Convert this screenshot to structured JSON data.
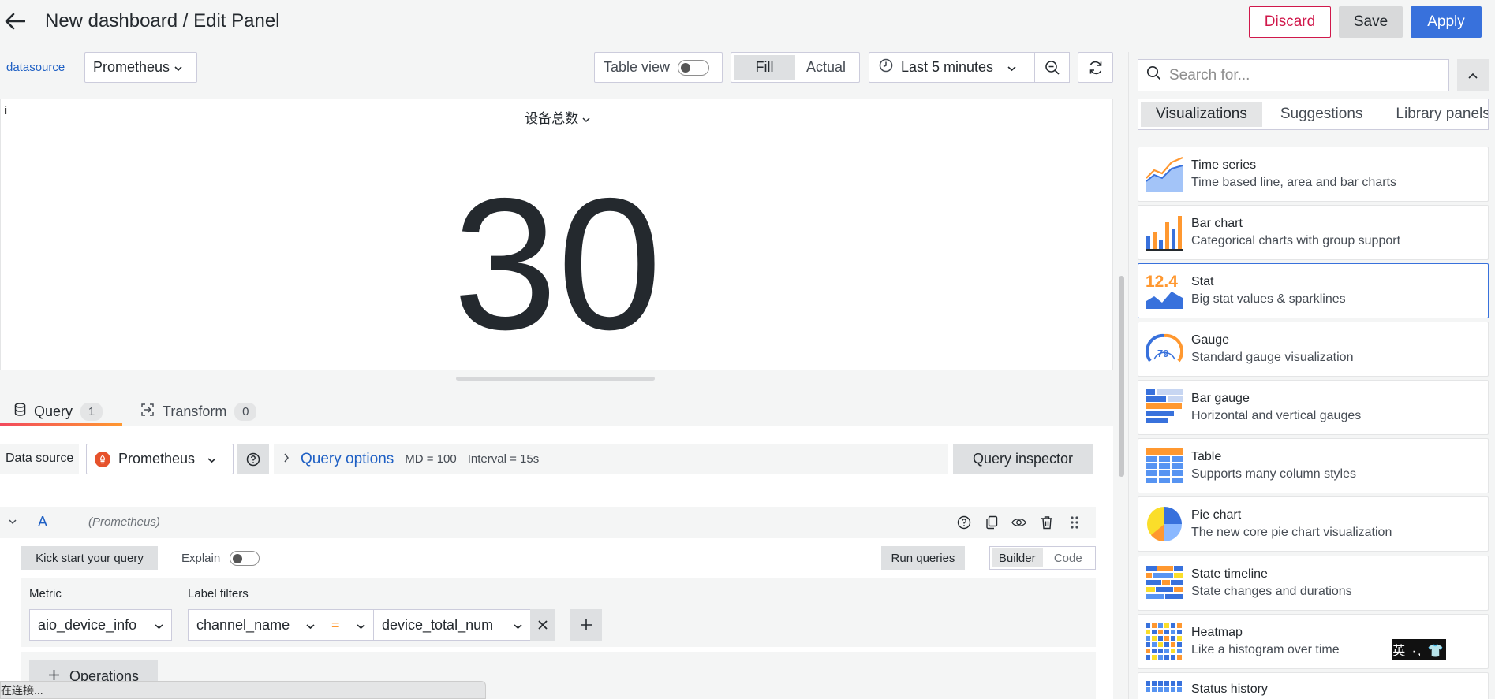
{
  "header": {
    "title": "New dashboard / Edit Panel",
    "discard_label": "Discard",
    "save_label": "Save",
    "apply_label": "Apply"
  },
  "toolbar": {
    "variable_label": "datasource",
    "variable_value": "Prometheus",
    "table_view_label": "Table view",
    "fill_label": "Fill",
    "actual_label": "Actual",
    "time_range": "Last 5 minutes"
  },
  "panel": {
    "title": "设备总数",
    "info_glyph": "i",
    "value": "30"
  },
  "query_tabs": {
    "query_label": "Query",
    "query_count": "1",
    "transform_label": "Transform",
    "transform_count": "0"
  },
  "query_bar": {
    "data_source_label": "Data source",
    "data_source_value": "Prometheus",
    "query_options_label": "Query options",
    "md": "MD = 100",
    "interval": "Interval = 15s",
    "inspector_label": "Query inspector"
  },
  "query_a": {
    "ref": "A",
    "datasource": "(Prometheus)",
    "kick_start_label": "Kick start your query",
    "explain_label": "Explain",
    "run_label": "Run queries",
    "builder_label": "Builder",
    "code_label": "Code",
    "metric_label": "Metric",
    "metric_value": "aio_device_info",
    "label_filters_label": "Label filters",
    "label_key": "channel_name",
    "operator": "=",
    "label_value": "device_total_num",
    "operations_label": "Operations"
  },
  "status_text": "在连接...",
  "right_pane": {
    "search_placeholder": "Search for...",
    "tabs": [
      "Visualizations",
      "Suggestions",
      "Library panels"
    ],
    "items": [
      {
        "name": "Time series",
        "desc": "Time based line, area and bar charts",
        "icon": "time-series-icon"
      },
      {
        "name": "Bar chart",
        "desc": "Categorical charts with group support",
        "icon": "bar-chart-icon"
      },
      {
        "name": "Stat",
        "desc": "Big stat values & sparklines",
        "icon": "stat-icon",
        "icon_value": "12.4"
      },
      {
        "name": "Gauge",
        "desc": "Standard gauge visualization",
        "icon": "gauge-icon",
        "icon_value": "79"
      },
      {
        "name": "Bar gauge",
        "desc": "Horizontal and vertical gauges",
        "icon": "bar-gauge-icon"
      },
      {
        "name": "Table",
        "desc": "Supports many column styles",
        "icon": "table-icon"
      },
      {
        "name": "Pie chart",
        "desc": "The new core pie chart visualization",
        "icon": "pie-chart-icon"
      },
      {
        "name": "State timeline",
        "desc": "State changes and durations",
        "icon": "state-timeline-icon"
      },
      {
        "name": "Heatmap",
        "desc": "Like a histogram over time",
        "icon": "heatmap-icon"
      },
      {
        "name": "Status history",
        "desc": "",
        "icon": "status-history-icon"
      }
    ]
  },
  "ime_indicator": "英 ·, 👕",
  "colors": {
    "primary": "#3871dc",
    "danger": "#d0184b",
    "link": "#1f60c4",
    "accent_orange": "#ff9830"
  }
}
